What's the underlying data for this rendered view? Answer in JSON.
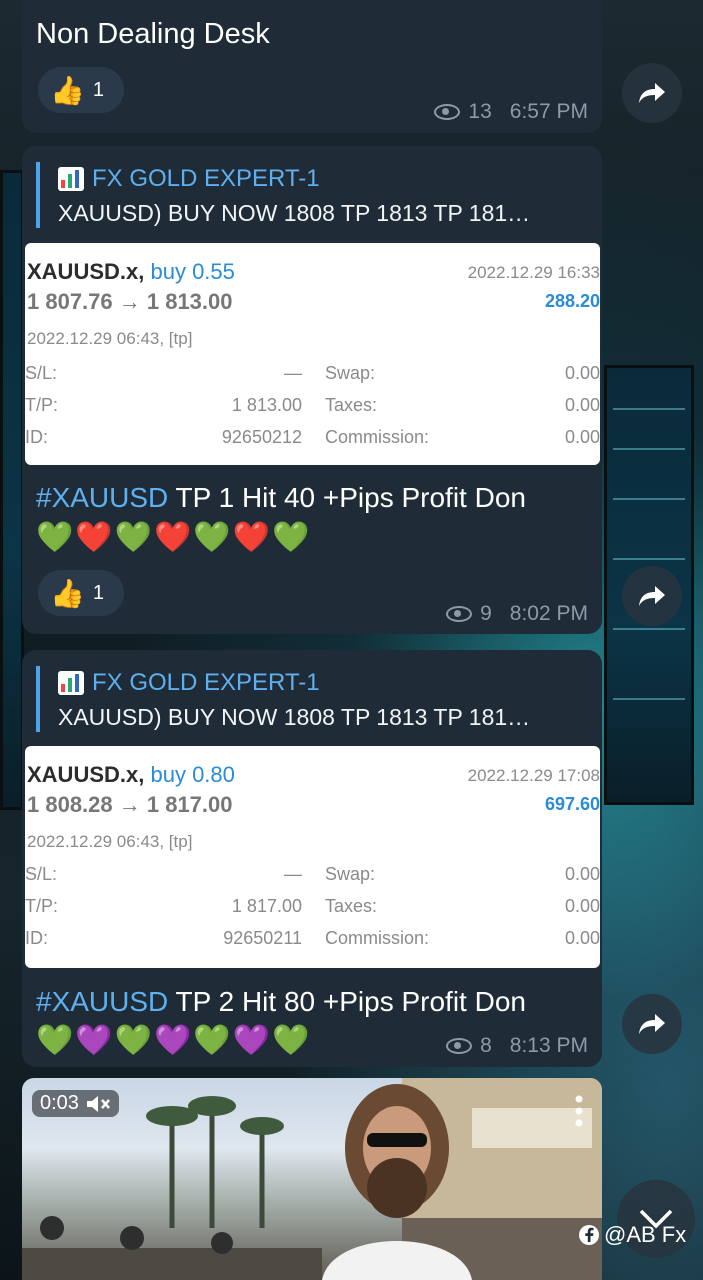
{
  "message0": {
    "text": "Non Dealing Desk",
    "reaction": {
      "emoji": "👍",
      "count": "1"
    },
    "views": "13",
    "time": "6:57 PM"
  },
  "message1": {
    "quote_title": "FX GOLD EXPERT-1",
    "quote_text": "XAUUSD) BUY NOW  1808 TP 1813 TP 181…",
    "card": {
      "symbol": "XAUUSD.x,",
      "side": "buy 0.55",
      "close_time": "2022.12.29 16:33",
      "prices": "1 807.76 → 1 813.00",
      "profit": "288.20",
      "open_time": "2022.12.29 06:43, [tp]",
      "sl_label": "S/L:",
      "sl_value": "—",
      "swap_label": "Swap:",
      "swap_value": "0.00",
      "tp_label": "T/P:",
      "tp_value": "1 813.00",
      "taxes_label": "Taxes:",
      "taxes_value": "0.00",
      "id_label": "ID:",
      "id_value": "92650212",
      "commission_label": "Commission:",
      "commission_value": "0.00"
    },
    "tag": "#XAUUSD",
    "text": " TP 1 Hit 40 +Pips Profit Don",
    "hearts": "💚❤️💚❤️💚❤️💚",
    "reaction": {
      "emoji": "👍",
      "count": "1"
    },
    "views": "9",
    "time": "8:02 PM"
  },
  "message2": {
    "quote_title": "FX GOLD EXPERT-1",
    "quote_text": "XAUUSD) BUY NOW  1808 TP 1813 TP 181…",
    "card": {
      "symbol": "XAUUSD.x,",
      "side": "buy 0.80",
      "close_time": "2022.12.29 17:08",
      "prices": "1 808.28 → 1 817.00",
      "profit": "697.60",
      "open_time": "2022.12.29 06:43, [tp]",
      "sl_label": "S/L:",
      "sl_value": "—",
      "swap_label": "Swap:",
      "swap_value": "0.00",
      "tp_label": "T/P:",
      "tp_value": "1 817.00",
      "taxes_label": "Taxes:",
      "taxes_value": "0.00",
      "id_label": "ID:",
      "id_value": "92650211",
      "commission_label": "Commission:",
      "commission_value": "0.00"
    },
    "tag": "#XAUUSD",
    "text": " TP 2 Hit 80 +Pips Profit Don",
    "hearts": "💚💜💚💜💚💜💚",
    "views": "8",
    "time": "8:13 PM"
  },
  "video": {
    "duration": "0:03",
    "watermark": "@AB Fx"
  },
  "icons": {
    "forward": "forward-arrow-icon",
    "eye": "eye-icon",
    "mute": "muted-speaker-icon",
    "more": "more-vertical-icon",
    "scroll_down": "chevron-down-icon",
    "facebook": "facebook-icon"
  }
}
